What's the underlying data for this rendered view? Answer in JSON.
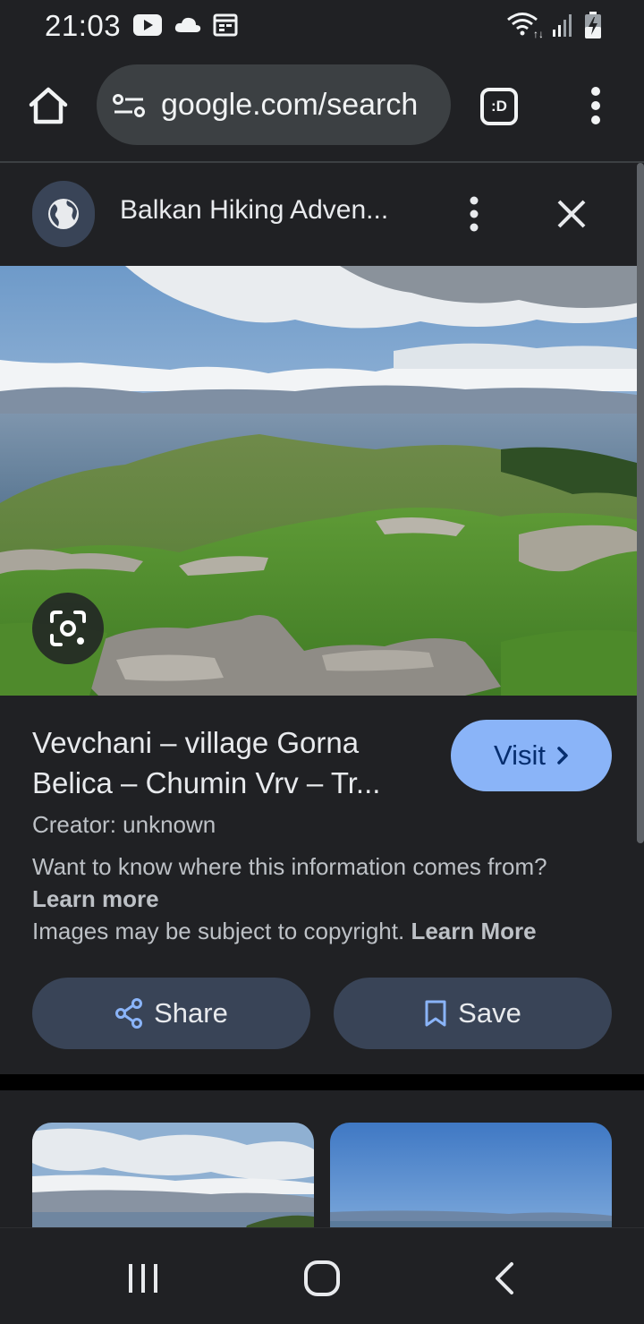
{
  "status_bar": {
    "time": "21:03",
    "left_icons": [
      "youtube-icon",
      "cloud-icon",
      "calendar-icon"
    ],
    "right_icons": [
      "wifi-icon",
      "signal-icon",
      "battery-charging-icon"
    ]
  },
  "browser": {
    "url": "google.com/search",
    "tab_badge": ":D",
    "home_icon": "home-icon",
    "menu_icon": "more-vert-icon"
  },
  "sheet": {
    "site_name": "Balkan Hiking Adven...",
    "image_title": "Vevchani – village Gorna Belica – Chumin Vrv – Tr...",
    "visit_label": "Visit",
    "creator": "Creator: unknown",
    "info_question": "Want to know where this information comes from?",
    "info_learn_more": "Learn more",
    "copyright_text": "Images may be subject to copyright.",
    "copyright_learn_more": "Learn More",
    "share_label": "Share",
    "save_label": "Save"
  },
  "colors": {
    "background": "#202124",
    "accent": "#8ab4f8",
    "button_bg": "#394457"
  }
}
